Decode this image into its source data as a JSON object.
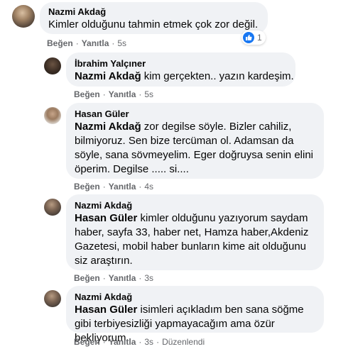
{
  "comments": [
    {
      "author": "Nazmi Akdağ",
      "mention": "",
      "text": "Kimler olduğunu tahmin etmek çok zor değil.",
      "like_label": "Beğen",
      "reply_label": "Yanıtla",
      "time": "5s",
      "edited": "",
      "reaction_count": "1"
    },
    {
      "author": "İbrahim Yalçıner",
      "mention": "Nazmi Akdağ",
      "text": " kim gerçekten.. yazın kardeşim.",
      "like_label": "Beğen",
      "reply_label": "Yanıtla",
      "time": "5s",
      "edited": ""
    },
    {
      "author": "Hasan Güler",
      "mention": "Nazmi Akdağ",
      "text": " zor degilse söyle. Bizler cahiliz, bilmiyoruz. Sen bize tercüman ol. Adamsan da söyle, sana sövmeyelim. Eger doğruysa senin elini öperim. Degilse ..... si....",
      "like_label": "Beğen",
      "reply_label": "Yanıtla",
      "time": "4s",
      "edited": ""
    },
    {
      "author": "Nazmi Akdağ",
      "mention": "Hasan Güler",
      "text": " kimler olduğunu yazıyorum saydam haber, sayfa 33, haber net, Hamza haber,Akdeniz Gazetesi, mobil haber bunların kime ait olduğunu siz araştırın.",
      "like_label": "Beğen",
      "reply_label": "Yanıtla",
      "time": "3s",
      "edited": ""
    },
    {
      "author": "Nazmi Akdağ",
      "mention": "Hasan Güler",
      "text": " isimleri açıkladım ben sana söğme gibi terbiyesizliği yapmayacağım ama özür bekliyorum",
      "like_label": "Beğen",
      "reply_label": "Yanıtla",
      "time": "3s",
      "edited": "Düzenlendi"
    }
  ],
  "separator": "·",
  "colors": {
    "bubble": "#f0f2f5",
    "secondary_text": "#65676b",
    "like_blue": "#1877f2"
  },
  "icons": {
    "reaction": "like-thumb-icon"
  }
}
